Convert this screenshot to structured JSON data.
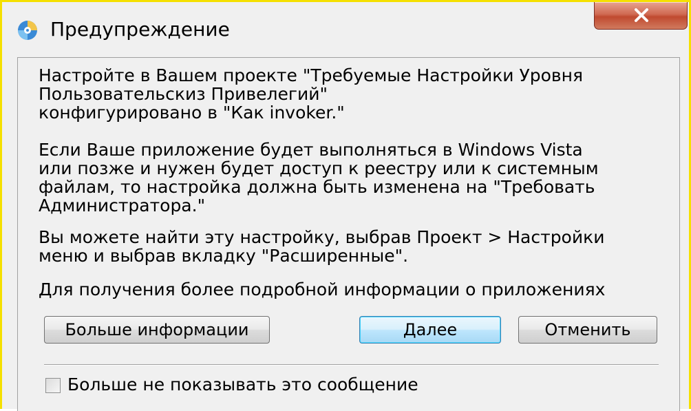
{
  "dialog": {
    "title": "Предупреждение",
    "icon": "app-disc-icon",
    "close_icon": "close-icon"
  },
  "message": {
    "paragraph1": "Настройте в Вашем проекте \"Требуемые Настройки Уровня\nПользовательскиз Привелегий\"\nконфигурировано в \"Как invoker.\"",
    "paragraph2": "Если Ваше приложение будет выполняться в Windows Vista\nили позже и нужен будет доступ к реестру или к системным\nфайлам, то настройка должна быть изменена на \"Требовать\nАдминистратора.\"",
    "paragraph3": "Вы можете найти эту настройку, выбрав Проект > Настройки\nменю и выбрав вкладку \"Расширенные\".",
    "paragraph4": "Для получения более подробной информации о приложениях"
  },
  "buttons": {
    "more_info": "Больше информации",
    "next": "Далее",
    "cancel": "Отменить"
  },
  "checkbox": {
    "label": "Больше не показывать это сообщение",
    "checked": false
  },
  "colors": {
    "frame_highlight": "#f5e000",
    "close_button": "#c04a30",
    "default_button_border": "#3c7fb1"
  }
}
